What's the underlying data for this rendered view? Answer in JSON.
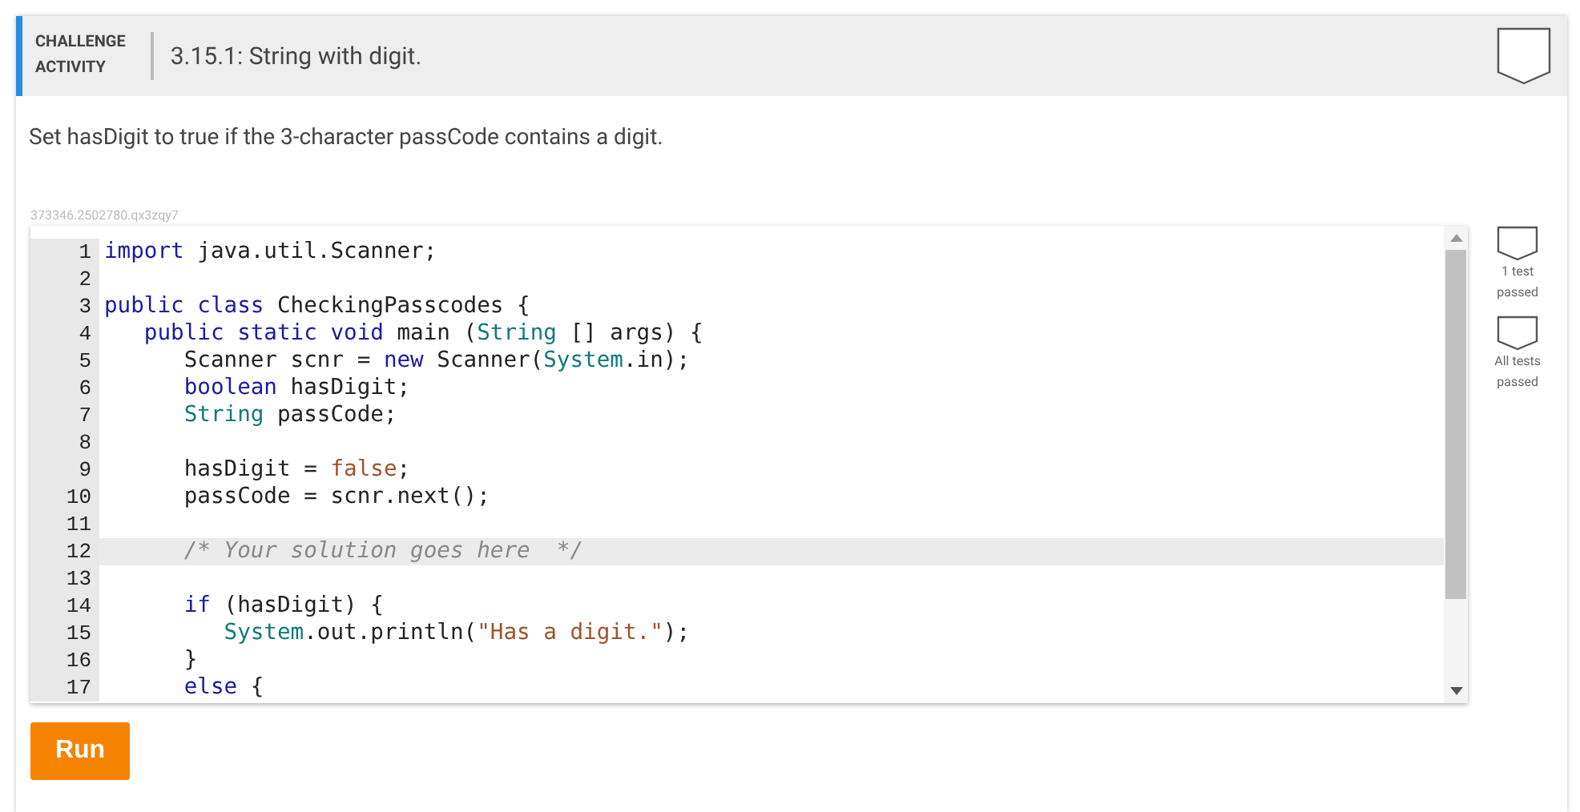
{
  "header": {
    "label_lines": [
      "CHALLENGE",
      "ACTIVITY"
    ],
    "title": "3.15.1: String with digit.",
    "completed": false
  },
  "instructions": "Set hasDigit to true if the 3-character passCode contains a digit.",
  "activity_id": "373346.2502780.qx3zqy7",
  "editor": {
    "lines": [
      {
        "number": "1",
        "active": false,
        "tokens": [
          {
            "kind": "keyword",
            "text": "import"
          },
          {
            "kind": "plain",
            "text": " java.util.Scanner;"
          }
        ]
      },
      {
        "number": "2",
        "active": false
      },
      {
        "number": "3",
        "active": false,
        "tokens": [
          {
            "kind": "keyword",
            "text": "public class"
          },
          {
            "kind": "plain",
            "text": " CheckingPasscodes {"
          }
        ]
      },
      {
        "number": "4",
        "active": false,
        "tokens": [
          {
            "kind": "keyword",
            "text": "   public static void"
          },
          {
            "kind": "plain",
            "text": " main ("
          },
          {
            "kind": "type",
            "text": "String"
          },
          {
            "kind": "plain",
            "text": " [] args) {"
          }
        ]
      },
      {
        "number": "5",
        "active": false,
        "tokens": [
          {
            "kind": "plain",
            "text": "      Scanner scnr = "
          },
          {
            "kind": "keyword",
            "text": "new"
          },
          {
            "kind": "plain",
            "text": " Scanner("
          },
          {
            "kind": "type",
            "text": "System"
          },
          {
            "kind": "plain",
            "text": ".in);"
          }
        ]
      },
      {
        "number": "6",
        "active": false,
        "tokens": [
          {
            "kind": "keyword",
            "text": "      boolean"
          },
          {
            "kind": "plain",
            "text": " hasDigit;"
          }
        ]
      },
      {
        "number": "7",
        "active": false,
        "tokens": [
          {
            "kind": "type",
            "text": "      String"
          },
          {
            "kind": "plain",
            "text": " passCode;"
          }
        ]
      },
      {
        "number": "8",
        "active": false
      },
      {
        "number": "9",
        "active": false,
        "tokens": [
          {
            "kind": "plain",
            "text": "      hasDigit = "
          },
          {
            "kind": "literal",
            "text": "false"
          },
          {
            "kind": "plain",
            "text": ";"
          }
        ]
      },
      {
        "number": "10",
        "active": false,
        "tokens": [
          {
            "kind": "plain",
            "text": "      passCode = scnr.next();"
          }
        ]
      },
      {
        "number": "11",
        "active": false
      },
      {
        "number": "12",
        "active": true,
        "tokens": [
          {
            "kind": "comment",
            "text": "      /* Your solution goes here  */"
          }
        ]
      },
      {
        "number": "13",
        "active": false
      },
      {
        "number": "14",
        "active": false,
        "tokens": [
          {
            "kind": "keyword",
            "text": "      if"
          },
          {
            "kind": "plain",
            "text": " (hasDigit) {"
          }
        ]
      },
      {
        "number": "15",
        "active": false,
        "tokens": [
          {
            "kind": "type",
            "text": "         System"
          },
          {
            "kind": "plain",
            "text": ".out.println("
          },
          {
            "kind": "string",
            "text": "\"Has a digit.\""
          },
          {
            "kind": "plain",
            "text": ");"
          }
        ]
      },
      {
        "number": "16",
        "active": false,
        "tokens": [
          {
            "kind": "plain",
            "text": "      }"
          }
        ]
      },
      {
        "number": "17",
        "active": false,
        "tokens": [
          {
            "kind": "keyword",
            "text": "      else"
          },
          {
            "kind": "plain",
            "text": " {"
          }
        ]
      }
    ]
  },
  "progress": [
    {
      "label": "1 test passed",
      "completed": false
    },
    {
      "label": "All tests passed",
      "completed": false
    }
  ],
  "run_button": "Run"
}
